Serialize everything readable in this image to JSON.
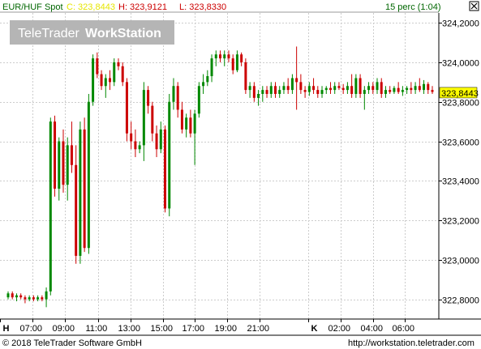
{
  "header": {
    "symbol": "EUR/HUF Spot",
    "close": "C: 323,8443",
    "high": "H: 323,9121",
    "low": "L: 323,8330",
    "period": "15 perc (1:04)"
  },
  "logo": {
    "part1": "TeleTrader",
    "part2": "WorkStation"
  },
  "last_price_label": "323,8443",
  "footer": {
    "copyright": "© 2018 TeleTrader Software GmbH",
    "url": "http://workstation.teletrader.com"
  },
  "colors": {
    "up": "#008800",
    "down": "#cc0000",
    "grid": "#cccccc",
    "last_tag": "#ffff00"
  },
  "chart_data": {
    "type": "candlestick",
    "ylim": [
      322.7,
      324.25
    ],
    "y_ticks": [
      "324,2000",
      "324,0000",
      "323,8000",
      "323,6000",
      "323,4000",
      "323,2000",
      "323,0000",
      "322,8000"
    ],
    "y_tick_values": [
      324.2,
      324.0,
      323.8,
      323.6,
      323.4,
      323.2,
      323.0,
      322.8
    ],
    "x_ticks": [
      "H",
      "07:00",
      "09:00",
      "11:00",
      "13:00",
      "15:00",
      "17:00",
      "19:00",
      "21:00",
      "K",
      "02:00",
      "04:00",
      "06:00"
    ],
    "grid": true,
    "candles": [
      [
        322.81,
        322.84,
        322.8,
        322.83
      ],
      [
        322.83,
        322.84,
        322.8,
        322.81
      ],
      [
        322.81,
        322.83,
        322.79,
        322.82
      ],
      [
        322.82,
        322.83,
        322.8,
        322.81
      ],
      [
        322.81,
        322.82,
        322.78,
        322.8
      ],
      [
        322.8,
        322.82,
        322.79,
        322.81
      ],
      [
        322.81,
        322.82,
        322.79,
        322.8
      ],
      [
        322.8,
        322.82,
        322.79,
        322.81
      ],
      [
        322.81,
        322.82,
        322.79,
        322.8
      ],
      [
        322.8,
        322.86,
        322.76,
        322.84
      ],
      [
        322.84,
        323.72,
        322.82,
        323.7
      ],
      [
        323.7,
        323.73,
        323.32,
        323.36
      ],
      [
        323.36,
        323.62,
        323.3,
        323.6
      ],
      [
        323.6,
        323.66,
        323.34,
        323.38
      ],
      [
        323.38,
        323.62,
        323.3,
        323.58
      ],
      [
        323.58,
        323.7,
        323.44,
        323.48
      ],
      [
        323.48,
        323.58,
        322.98,
        323.02
      ],
      [
        323.02,
        323.7,
        322.98,
        323.66
      ],
      [
        323.66,
        323.72,
        323.04,
        323.06
      ],
      [
        323.06,
        323.84,
        323.03,
        323.8
      ],
      [
        323.8,
        324.04,
        323.78,
        324.02
      ],
      [
        324.02,
        324.05,
        323.92,
        323.94
      ],
      [
        323.94,
        323.96,
        323.86,
        323.88
      ],
      [
        323.88,
        323.94,
        323.82,
        323.92
      ],
      [
        323.92,
        323.96,
        323.86,
        323.9
      ],
      [
        323.9,
        324.02,
        323.88,
        324.0
      ],
      [
        324.0,
        324.02,
        323.96,
        323.98
      ],
      [
        323.98,
        324.0,
        323.88,
        323.9
      ],
      [
        323.9,
        323.92,
        323.6,
        323.64
      ],
      [
        323.64,
        323.7,
        323.56,
        323.6
      ],
      [
        323.6,
        323.66,
        323.52,
        323.56
      ],
      [
        323.56,
        323.6,
        323.54,
        323.58
      ],
      [
        323.58,
        323.9,
        323.5,
        323.86
      ],
      [
        323.86,
        323.88,
        323.74,
        323.78
      ],
      [
        323.78,
        323.8,
        323.6,
        323.64
      ],
      [
        323.64,
        323.68,
        323.52,
        323.56
      ],
      [
        323.56,
        323.7,
        323.54,
        323.66
      ],
      [
        323.66,
        323.68,
        323.24,
        323.26
      ],
      [
        323.26,
        323.84,
        323.22,
        323.8
      ],
      [
        323.8,
        323.92,
        323.76,
        323.88
      ],
      [
        323.88,
        323.9,
        323.72,
        323.76
      ],
      [
        323.76,
        323.8,
        323.64,
        323.66
      ],
      [
        323.66,
        323.74,
        323.62,
        323.72
      ],
      [
        323.72,
        323.76,
        323.62,
        323.64
      ],
      [
        323.64,
        323.76,
        323.48,
        323.74
      ],
      [
        323.74,
        323.9,
        323.72,
        323.88
      ],
      [
        323.88,
        323.94,
        323.84,
        323.9
      ],
      [
        323.9,
        323.96,
        323.88,
        323.93
      ],
      [
        323.93,
        324.04,
        323.9,
        324.02
      ],
      [
        324.02,
        324.06,
        323.98,
        324.04
      ],
      [
        324.04,
        324.06,
        324.0,
        324.02
      ],
      [
        324.02,
        324.06,
        323.98,
        324.04
      ],
      [
        324.04,
        324.06,
        324.0,
        324.02
      ],
      [
        324.02,
        324.04,
        323.94,
        323.96
      ],
      [
        323.96,
        324.06,
        323.95,
        324.04
      ],
      [
        324.04,
        324.05,
        323.98,
        324.0
      ],
      [
        324.0,
        324.02,
        323.84,
        323.86
      ],
      [
        323.86,
        323.9,
        323.82,
        323.88
      ],
      [
        323.88,
        323.9,
        323.8,
        323.82
      ],
      [
        323.82,
        323.86,
        323.78,
        323.84
      ],
      [
        323.84,
        323.88,
        323.8,
        323.86
      ],
      [
        323.86,
        323.88,
        323.82,
        323.84
      ],
      [
        323.84,
        323.9,
        323.82,
        323.88
      ],
      [
        323.88,
        323.9,
        323.82,
        323.84
      ],
      [
        323.84,
        323.88,
        323.82,
        323.86
      ],
      [
        323.86,
        323.9,
        323.84,
        323.88
      ],
      [
        323.88,
        323.92,
        323.84,
        323.86
      ],
      [
        323.86,
        323.94,
        323.84,
        323.92
      ],
      [
        323.92,
        324.08,
        323.76,
        323.9
      ],
      [
        323.9,
        323.94,
        323.84,
        323.86
      ],
      [
        323.86,
        323.88,
        323.82,
        323.85
      ],
      [
        323.85,
        323.9,
        323.83,
        323.88
      ],
      [
        323.88,
        323.92,
        323.84,
        323.86
      ],
      [
        323.86,
        323.88,
        323.82,
        323.84
      ],
      [
        323.84,
        323.88,
        323.82,
        323.86
      ],
      [
        323.86,
        323.88,
        323.84,
        323.87
      ],
      [
        323.87,
        323.9,
        323.84,
        323.86
      ],
      [
        323.86,
        323.9,
        323.84,
        323.88
      ],
      [
        323.88,
        323.9,
        323.86,
        323.87
      ],
      [
        323.87,
        323.89,
        323.84,
        323.86
      ],
      [
        323.86,
        323.9,
        323.84,
        323.88
      ],
      [
        323.88,
        323.94,
        323.82,
        323.84
      ],
      [
        323.84,
        323.94,
        323.82,
        323.92
      ],
      [
        323.92,
        323.94,
        323.82,
        323.84
      ],
      [
        323.84,
        323.88,
        323.76,
        323.86
      ],
      [
        323.86,
        323.9,
        323.84,
        323.88
      ],
      [
        323.88,
        323.9,
        323.84,
        323.86
      ],
      [
        323.86,
        323.92,
        323.84,
        323.9
      ],
      [
        323.9,
        323.92,
        323.82,
        323.84
      ],
      [
        323.84,
        323.88,
        323.82,
        323.86
      ],
      [
        323.86,
        323.88,
        323.84,
        323.85
      ],
      [
        323.85,
        323.88,
        323.84,
        323.87
      ],
      [
        323.87,
        323.9,
        323.84,
        323.85
      ],
      [
        323.85,
        323.88,
        323.83,
        323.86
      ],
      [
        323.86,
        323.88,
        323.84,
        323.87
      ],
      [
        323.87,
        323.9,
        323.84,
        323.86
      ],
      [
        323.86,
        323.9,
        323.84,
        323.88
      ],
      [
        323.88,
        323.92,
        323.85,
        323.86
      ],
      [
        323.86,
        323.91,
        323.84,
        323.89
      ],
      [
        323.89,
        323.9,
        323.84,
        323.86
      ],
      [
        323.86,
        323.88,
        323.84,
        323.85
      ]
    ],
    "last": 323.8443
  }
}
